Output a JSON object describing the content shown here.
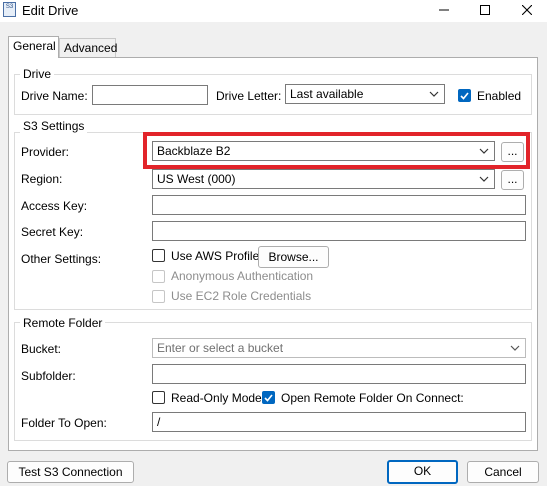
{
  "window": {
    "icon_text": "S3",
    "title": "Edit Drive"
  },
  "tabs": [
    {
      "label": "General"
    },
    {
      "label": "Advanced"
    }
  ],
  "drive": {
    "group_label": "Drive",
    "name_label": "Drive Name:",
    "name_value": "",
    "letter_label": "Drive Letter:",
    "letter_value": "Last available",
    "enabled_label": "Enabled",
    "enabled_checked": true
  },
  "s3": {
    "group_label": "S3 Settings",
    "provider_label": "Provider:",
    "provider_value": "Backblaze B2",
    "provider_more": "...",
    "region_label": "Region:",
    "region_value": "US West (000)",
    "region_more": "...",
    "access_key_label": "Access Key:",
    "access_key_value": "",
    "secret_key_label": "Secret Key:",
    "secret_key_value": "",
    "other_label": "Other Settings:",
    "use_aws_profile": "Use AWS Profile",
    "browse_button": "Browse...",
    "anonymous_auth": "Anonymous Authentication",
    "ec2_role": "Use EC2 Role Credentials"
  },
  "remote": {
    "group_label": "Remote Folder",
    "bucket_label": "Bucket:",
    "bucket_placeholder": "Enter or select a bucket",
    "subfolder_label": "Subfolder:",
    "subfolder_value": "",
    "read_only": "Read-Only Mode",
    "open_on_connect": "Open Remote Folder On Connect:",
    "open_on_connect_checked": true,
    "folder_to_open_label": "Folder To Open:",
    "folder_to_open_value": "/"
  },
  "footer": {
    "test_button": "Test S3 Connection",
    "ok_button": "OK",
    "cancel_button": "Cancel"
  },
  "colors": {
    "accent": "#0067c0",
    "highlight_box": "#e2242a"
  }
}
